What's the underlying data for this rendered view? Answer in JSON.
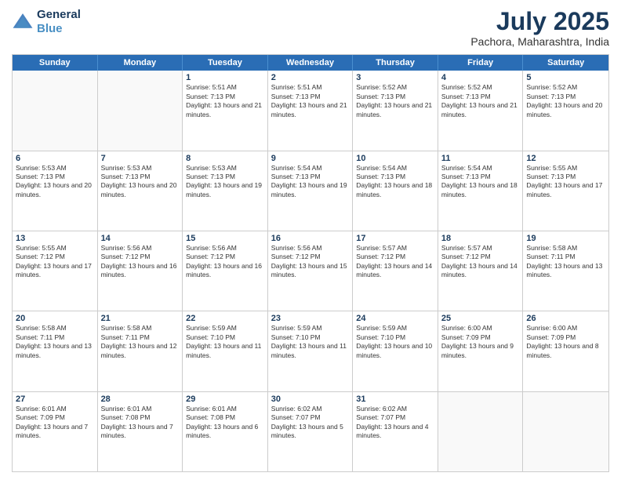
{
  "header": {
    "logo_line1": "General",
    "logo_line2": "Blue",
    "month": "July 2025",
    "location": "Pachora, Maharashtra, India"
  },
  "weekdays": [
    "Sunday",
    "Monday",
    "Tuesday",
    "Wednesday",
    "Thursday",
    "Friday",
    "Saturday"
  ],
  "rows": [
    [
      {
        "day": "",
        "sunrise": "",
        "sunset": "",
        "daylight": "",
        "empty": true
      },
      {
        "day": "",
        "sunrise": "",
        "sunset": "",
        "daylight": "",
        "empty": true
      },
      {
        "day": "1",
        "sunrise": "Sunrise: 5:51 AM",
        "sunset": "Sunset: 7:13 PM",
        "daylight": "Daylight: 13 hours and 21 minutes."
      },
      {
        "day": "2",
        "sunrise": "Sunrise: 5:51 AM",
        "sunset": "Sunset: 7:13 PM",
        "daylight": "Daylight: 13 hours and 21 minutes."
      },
      {
        "day": "3",
        "sunrise": "Sunrise: 5:52 AM",
        "sunset": "Sunset: 7:13 PM",
        "daylight": "Daylight: 13 hours and 21 minutes."
      },
      {
        "day": "4",
        "sunrise": "Sunrise: 5:52 AM",
        "sunset": "Sunset: 7:13 PM",
        "daylight": "Daylight: 13 hours and 21 minutes."
      },
      {
        "day": "5",
        "sunrise": "Sunrise: 5:52 AM",
        "sunset": "Sunset: 7:13 PM",
        "daylight": "Daylight: 13 hours and 20 minutes."
      }
    ],
    [
      {
        "day": "6",
        "sunrise": "Sunrise: 5:53 AM",
        "sunset": "Sunset: 7:13 PM",
        "daylight": "Daylight: 13 hours and 20 minutes."
      },
      {
        "day": "7",
        "sunrise": "Sunrise: 5:53 AM",
        "sunset": "Sunset: 7:13 PM",
        "daylight": "Daylight: 13 hours and 20 minutes."
      },
      {
        "day": "8",
        "sunrise": "Sunrise: 5:53 AM",
        "sunset": "Sunset: 7:13 PM",
        "daylight": "Daylight: 13 hours and 19 minutes."
      },
      {
        "day": "9",
        "sunrise": "Sunrise: 5:54 AM",
        "sunset": "Sunset: 7:13 PM",
        "daylight": "Daylight: 13 hours and 19 minutes."
      },
      {
        "day": "10",
        "sunrise": "Sunrise: 5:54 AM",
        "sunset": "Sunset: 7:13 PM",
        "daylight": "Daylight: 13 hours and 18 minutes."
      },
      {
        "day": "11",
        "sunrise": "Sunrise: 5:54 AM",
        "sunset": "Sunset: 7:13 PM",
        "daylight": "Daylight: 13 hours and 18 minutes."
      },
      {
        "day": "12",
        "sunrise": "Sunrise: 5:55 AM",
        "sunset": "Sunset: 7:13 PM",
        "daylight": "Daylight: 13 hours and 17 minutes."
      }
    ],
    [
      {
        "day": "13",
        "sunrise": "Sunrise: 5:55 AM",
        "sunset": "Sunset: 7:12 PM",
        "daylight": "Daylight: 13 hours and 17 minutes."
      },
      {
        "day": "14",
        "sunrise": "Sunrise: 5:56 AM",
        "sunset": "Sunset: 7:12 PM",
        "daylight": "Daylight: 13 hours and 16 minutes."
      },
      {
        "day": "15",
        "sunrise": "Sunrise: 5:56 AM",
        "sunset": "Sunset: 7:12 PM",
        "daylight": "Daylight: 13 hours and 16 minutes."
      },
      {
        "day": "16",
        "sunrise": "Sunrise: 5:56 AM",
        "sunset": "Sunset: 7:12 PM",
        "daylight": "Daylight: 13 hours and 15 minutes."
      },
      {
        "day": "17",
        "sunrise": "Sunrise: 5:57 AM",
        "sunset": "Sunset: 7:12 PM",
        "daylight": "Daylight: 13 hours and 14 minutes."
      },
      {
        "day": "18",
        "sunrise": "Sunrise: 5:57 AM",
        "sunset": "Sunset: 7:12 PM",
        "daylight": "Daylight: 13 hours and 14 minutes."
      },
      {
        "day": "19",
        "sunrise": "Sunrise: 5:58 AM",
        "sunset": "Sunset: 7:11 PM",
        "daylight": "Daylight: 13 hours and 13 minutes."
      }
    ],
    [
      {
        "day": "20",
        "sunrise": "Sunrise: 5:58 AM",
        "sunset": "Sunset: 7:11 PM",
        "daylight": "Daylight: 13 hours and 13 minutes."
      },
      {
        "day": "21",
        "sunrise": "Sunrise: 5:58 AM",
        "sunset": "Sunset: 7:11 PM",
        "daylight": "Daylight: 13 hours and 12 minutes."
      },
      {
        "day": "22",
        "sunrise": "Sunrise: 5:59 AM",
        "sunset": "Sunset: 7:10 PM",
        "daylight": "Daylight: 13 hours and 11 minutes."
      },
      {
        "day": "23",
        "sunrise": "Sunrise: 5:59 AM",
        "sunset": "Sunset: 7:10 PM",
        "daylight": "Daylight: 13 hours and 11 minutes."
      },
      {
        "day": "24",
        "sunrise": "Sunrise: 5:59 AM",
        "sunset": "Sunset: 7:10 PM",
        "daylight": "Daylight: 13 hours and 10 minutes."
      },
      {
        "day": "25",
        "sunrise": "Sunrise: 6:00 AM",
        "sunset": "Sunset: 7:09 PM",
        "daylight": "Daylight: 13 hours and 9 minutes."
      },
      {
        "day": "26",
        "sunrise": "Sunrise: 6:00 AM",
        "sunset": "Sunset: 7:09 PM",
        "daylight": "Daylight: 13 hours and 8 minutes."
      }
    ],
    [
      {
        "day": "27",
        "sunrise": "Sunrise: 6:01 AM",
        "sunset": "Sunset: 7:09 PM",
        "daylight": "Daylight: 13 hours and 7 minutes."
      },
      {
        "day": "28",
        "sunrise": "Sunrise: 6:01 AM",
        "sunset": "Sunset: 7:08 PM",
        "daylight": "Daylight: 13 hours and 7 minutes."
      },
      {
        "day": "29",
        "sunrise": "Sunrise: 6:01 AM",
        "sunset": "Sunset: 7:08 PM",
        "daylight": "Daylight: 13 hours and 6 minutes."
      },
      {
        "day": "30",
        "sunrise": "Sunrise: 6:02 AM",
        "sunset": "Sunset: 7:07 PM",
        "daylight": "Daylight: 13 hours and 5 minutes."
      },
      {
        "day": "31",
        "sunrise": "Sunrise: 6:02 AM",
        "sunset": "Sunset: 7:07 PM",
        "daylight": "Daylight: 13 hours and 4 minutes."
      },
      {
        "day": "",
        "sunrise": "",
        "sunset": "",
        "daylight": "",
        "empty": true
      },
      {
        "day": "",
        "sunrise": "",
        "sunset": "",
        "daylight": "",
        "empty": true
      }
    ]
  ]
}
